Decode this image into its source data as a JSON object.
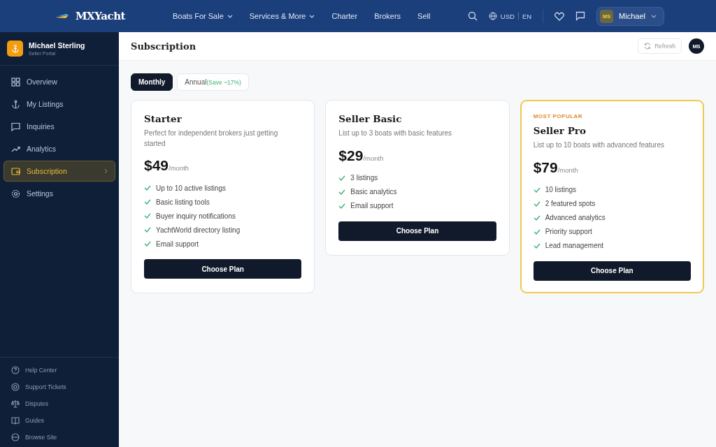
{
  "topbar": {
    "logo": "MXYacht",
    "nav": [
      {
        "label": "Boats For Sale",
        "dropdown": true
      },
      {
        "label": "Services & More",
        "dropdown": true
      },
      {
        "label": "Charter",
        "dropdown": false
      },
      {
        "label": "Brokers",
        "dropdown": false
      },
      {
        "label": "Sell",
        "dropdown": false
      }
    ],
    "currency": "USD",
    "language": "EN",
    "user": {
      "initials": "MS",
      "name": "Michael"
    }
  },
  "sidebar": {
    "user": {
      "name": "Michael Sterling",
      "role": "Seller Portal"
    },
    "items": [
      {
        "label": "Overview",
        "selected": false
      },
      {
        "label": "My Listings",
        "selected": false
      },
      {
        "label": "Inquiries",
        "selected": false
      },
      {
        "label": "Analytics",
        "selected": false
      },
      {
        "label": "Subscription",
        "selected": true
      },
      {
        "label": "Settings",
        "selected": false
      }
    ],
    "footer_items": [
      "Help Center",
      "Support Tickets",
      "Disputes",
      "Guides",
      "Browse Site"
    ]
  },
  "header": {
    "title": "Subscription",
    "refresh": "Refresh",
    "avatar": "MS"
  },
  "billing_tabs": [
    {
      "label": "Monthly",
      "selected": true
    },
    {
      "label": "Annual",
      "note": "(Save ~17%)",
      "selected": false
    }
  ],
  "plans": [
    {
      "name": "Starter",
      "description": "Perfect for independent brokers just getting started",
      "price": "$49",
      "period": "/month",
      "featured": false,
      "features": [
        "Up to 10 active listings",
        "Basic listing tools",
        "Buyer inquiry notifications",
        "YachtWorld directory listing",
        "Email support"
      ],
      "button": "Choose Plan"
    },
    {
      "name": "Seller Basic",
      "description": "List up to 3 boats with basic features",
      "price": "$29",
      "period": "/month",
      "featured": false,
      "features": [
        "3 listings",
        "Basic analytics",
        "Email support"
      ],
      "button": "Choose Plan"
    },
    {
      "name": "Seller Pro",
      "badge": "MOST POPULAR",
      "description": "List up to 10 boats with advanced features",
      "price": "$79",
      "period": "/month",
      "featured": true,
      "features": [
        "10 listings",
        "2 featured spots",
        "Advanced analytics",
        "Priority support",
        "Lead management"
      ],
      "button": "Choose Plan"
    }
  ]
}
